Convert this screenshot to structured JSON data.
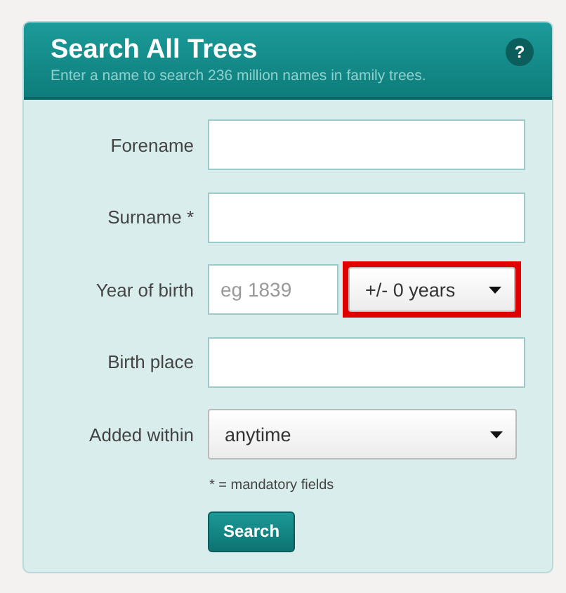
{
  "panel": {
    "title": "Search All Trees",
    "subtitle": "Enter a name to search 236 million names in family trees.",
    "help": "?"
  },
  "fields": [
    {
      "kind": "text",
      "label": "Forename"
    },
    {
      "kind": "text",
      "label": "Surname *"
    },
    {
      "kind": "year",
      "label": "Year of birth",
      "placeholder": "eg 1839",
      "range": {
        "value": "+/- 0 years",
        "highlighted": true
      }
    },
    {
      "kind": "text",
      "label": "Birth place"
    },
    {
      "kind": "select",
      "label": "Added within",
      "value": "anytime"
    }
  ],
  "note": "* = mandatory fields",
  "button": "Search"
}
